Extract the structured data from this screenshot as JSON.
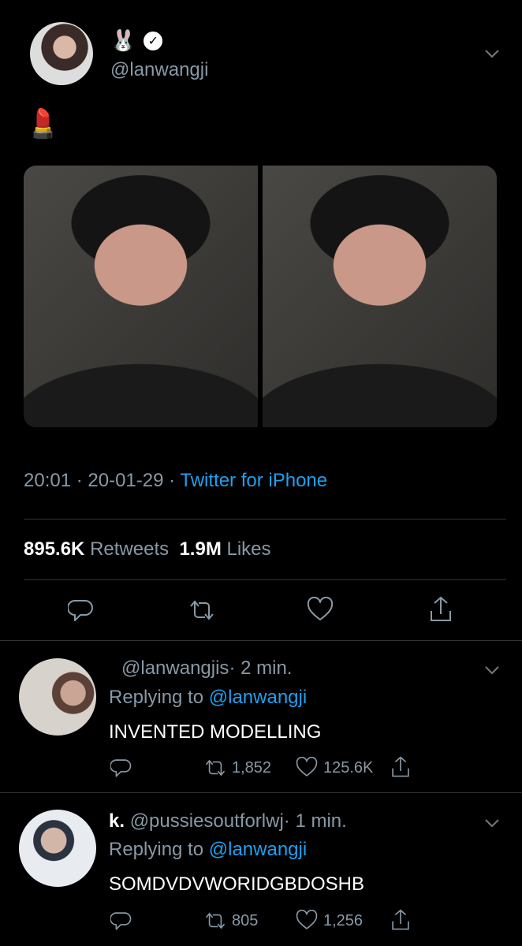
{
  "tweet": {
    "emojis": [
      "🐰"
    ],
    "verified_mark": "✓",
    "handle": "@lanwangji",
    "text": "💄",
    "timestamp": "20:01 · 20-01-29 · ",
    "source": "Twitter for iPhone",
    "retweets_count": "895.6K",
    "retweets_label": "Retweets",
    "likes_count": "1.9M",
    "likes_label": "Likes"
  },
  "replies": [
    {
      "name": "",
      "handle": "@lanwangjis",
      "time": "· 2 min.",
      "replying_to_label": "Replying to ",
      "replying_to": "@lanwangji",
      "text": "INVENTED MODELLING",
      "retweets": "1,852",
      "likes": "125.6K"
    },
    {
      "name": "k.",
      "handle": "@pussiesoutforlwj",
      "time": "· 1 min.",
      "replying_to_label": "Replying to ",
      "replying_to": "@lanwangji",
      "text": "SOMDVDVWORIDGBDOSHB",
      "retweets": "805",
      "likes": "1,256"
    }
  ],
  "icons": {
    "chevron": "chevron-down-icon",
    "reply": "reply-icon",
    "retweet": "retweet-icon",
    "like": "heart-icon",
    "share": "share-icon"
  },
  "colors": {
    "link": "#1da1f2",
    "muted": "#8899a6",
    "divider": "#2f3336"
  }
}
